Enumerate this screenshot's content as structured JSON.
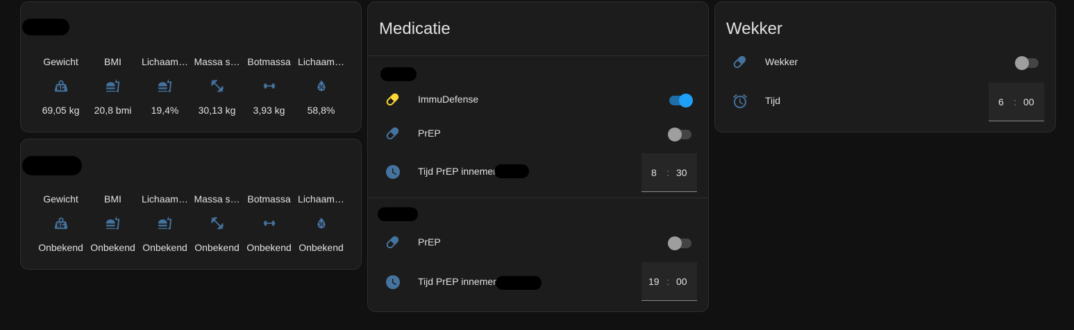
{
  "stats_top": {
    "items": [
      {
        "label": "Gewicht",
        "icon": "weight-kilogram-icon",
        "value": "69,05 kg"
      },
      {
        "label": "BMI",
        "icon": "food-icon",
        "value": "20,8 bmi"
      },
      {
        "label": "Lichaam…",
        "icon": "food-icon",
        "value": "19,4%"
      },
      {
        "label": "Massa s…",
        "icon": "dumbbell-icon",
        "value": "30,13 kg"
      },
      {
        "label": "Botmassa",
        "icon": "bone-icon",
        "value": "3,93 kg"
      },
      {
        "label": "Lichaam…",
        "icon": "water-percent-icon",
        "value": "58,8%"
      }
    ]
  },
  "stats_bottom": {
    "items": [
      {
        "label": "Gewicht",
        "icon": "weight-kilogram-icon",
        "value": "Onbekend"
      },
      {
        "label": "BMI",
        "icon": "food-icon",
        "value": "Onbekend"
      },
      {
        "label": "Lichaam…",
        "icon": "food-icon",
        "value": "Onbekend"
      },
      {
        "label": "Massa s…",
        "icon": "dumbbell-icon",
        "value": "Onbekend"
      },
      {
        "label": "Botmassa",
        "icon": "bone-icon",
        "value": "Onbekend"
      },
      {
        "label": "Lichaam…",
        "icon": "water-percent-icon",
        "value": "Onbekend"
      }
    ]
  },
  "medicatie": {
    "title": "Medicatie",
    "section1": {
      "rows": [
        {
          "label": "ImmuDefense",
          "icon": "pill-icon",
          "icon_color": "#fdd835",
          "toggle": "on"
        },
        {
          "label": "PrEP",
          "icon": "pill-icon",
          "icon_color": "#44739e",
          "toggle": "off"
        }
      ],
      "time": {
        "label": "Tijd PrEP innemen",
        "icon": "clock-icon",
        "hour": "8",
        "sep": ":",
        "minute": "30"
      }
    },
    "section2": {
      "rows": [
        {
          "label": "PrEP",
          "icon": "pill-icon",
          "icon_color": "#44739e",
          "toggle": "off"
        }
      ],
      "time": {
        "label": "Tijd PrEP innemen",
        "icon": "clock-icon",
        "hour": "19",
        "sep": ":",
        "minute": "00"
      }
    }
  },
  "wekker": {
    "title": "Wekker",
    "row": {
      "label": "Wekker",
      "icon": "pill-icon",
      "toggle": "off"
    },
    "time": {
      "label": "Tijd",
      "icon": "alarm-icon",
      "hour": "6",
      "sep": ":",
      "minute": "00"
    }
  },
  "colors": {
    "background": "#111111",
    "card": "#1c1c1c",
    "icon": "#44739e",
    "active_icon": "#fdd835",
    "toggle_on": "#1ea0f8"
  }
}
